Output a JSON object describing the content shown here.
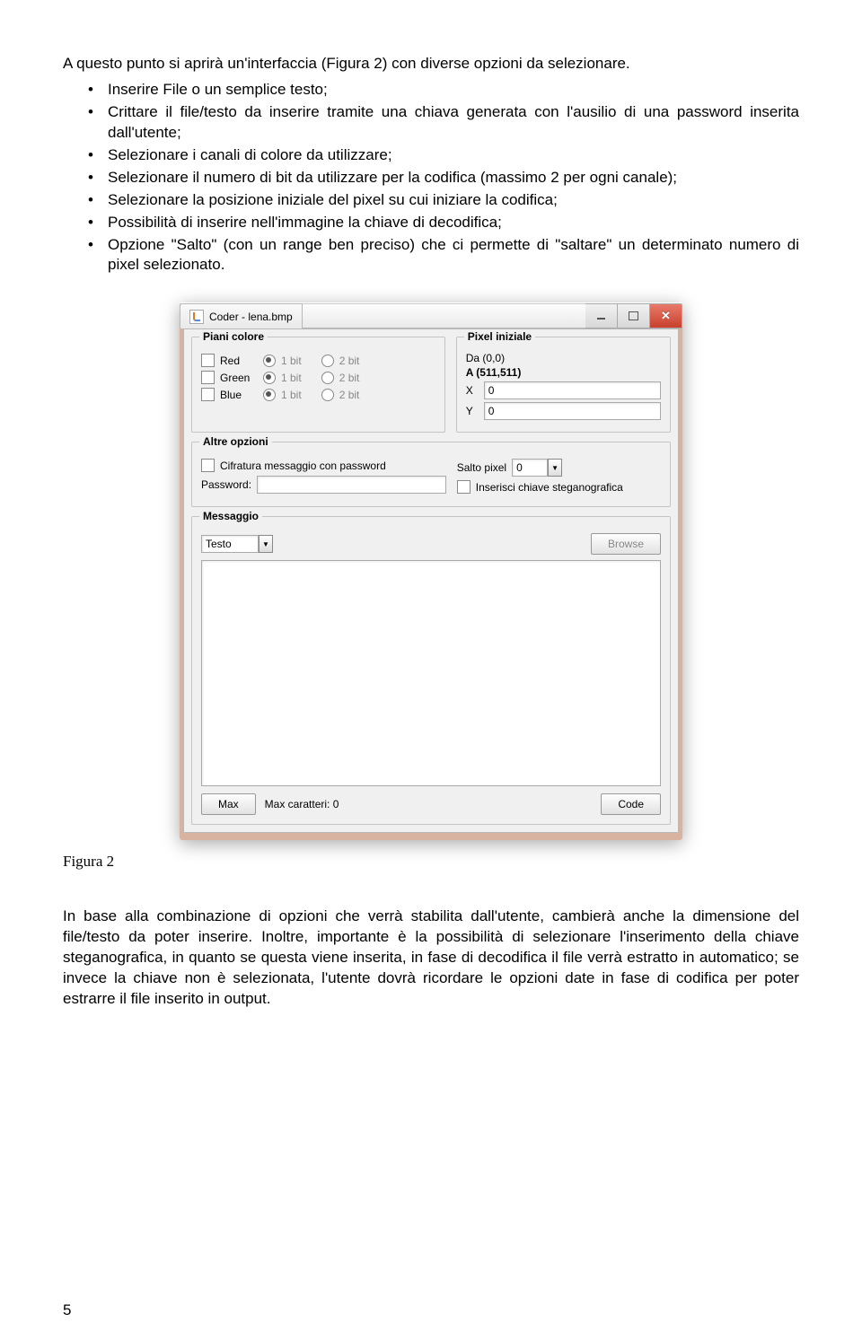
{
  "para_intro": "A questo punto si aprirà un'interfaccia (Figura 2) con diverse opzioni da selezionare.",
  "bullets": [
    "Inserire File o un semplice testo;",
    "Crittare il file/testo da inserire tramite una chiava generata con l'ausilio di una password inserita dall'utente;",
    "Selezionare i canali di colore da utilizzare;",
    "Selezionare il numero di bit da utilizzare per la codifica (massimo 2 per ogni canale);",
    "Selezionare la posizione iniziale del pixel su cui iniziare la codifica;",
    "Possibilità di inserire nell'immagine la chiave di decodifica;",
    "Opzione \"Salto\" (con un range ben preciso) che ci permette di \"saltare\" un determinato numero di pixel selezionato."
  ],
  "figcaption": "Figura 2",
  "para_outro": "In base alla combinazione di opzioni che verrà stabilita dall'utente, cambierà anche la dimensione del file/testo da poter inserire. Inoltre, importante è la possibilità di selezionare l'inserimento della chiave  steganografica, in quanto se questa viene inserita, in fase di decodifica il file verrà estratto in automatico; se invece la chiave non è selezionata, l'utente dovrà ricordare le opzioni date in fase di codifica per poter estrarre il file inserito in output.",
  "pagenum": "5",
  "win": {
    "title": "Coder - lena.bmp",
    "groups": {
      "piani": {
        "legend": "Piani colore",
        "rows": [
          {
            "name": "Red",
            "b1": "1 bit",
            "b2": "2 bit"
          },
          {
            "name": "Green",
            "b1": "1 bit",
            "b2": "2 bit"
          },
          {
            "name": "Blue",
            "b1": "1 bit",
            "b2": "2 bit"
          }
        ]
      },
      "pixel": {
        "legend": "Pixel iniziale",
        "da": "Da (0,0)",
        "a": "A (511,511)",
        "xlab": "X",
        "xval": "0",
        "ylab": "Y",
        "yval": "0"
      },
      "altre": {
        "legend": "Altre opzioni",
        "cif": "Cifratura messaggio con password",
        "pwd": "Password:",
        "salto": "Salto pixel",
        "saltoval": "0",
        "steg": "Inserisci chiave steganografica"
      },
      "msg": {
        "legend": "Messaggio",
        "mode": "Testo",
        "browse": "Browse"
      }
    },
    "footer": {
      "max": "Max",
      "maxchar": "Max caratteri: 0",
      "code": "Code"
    }
  }
}
